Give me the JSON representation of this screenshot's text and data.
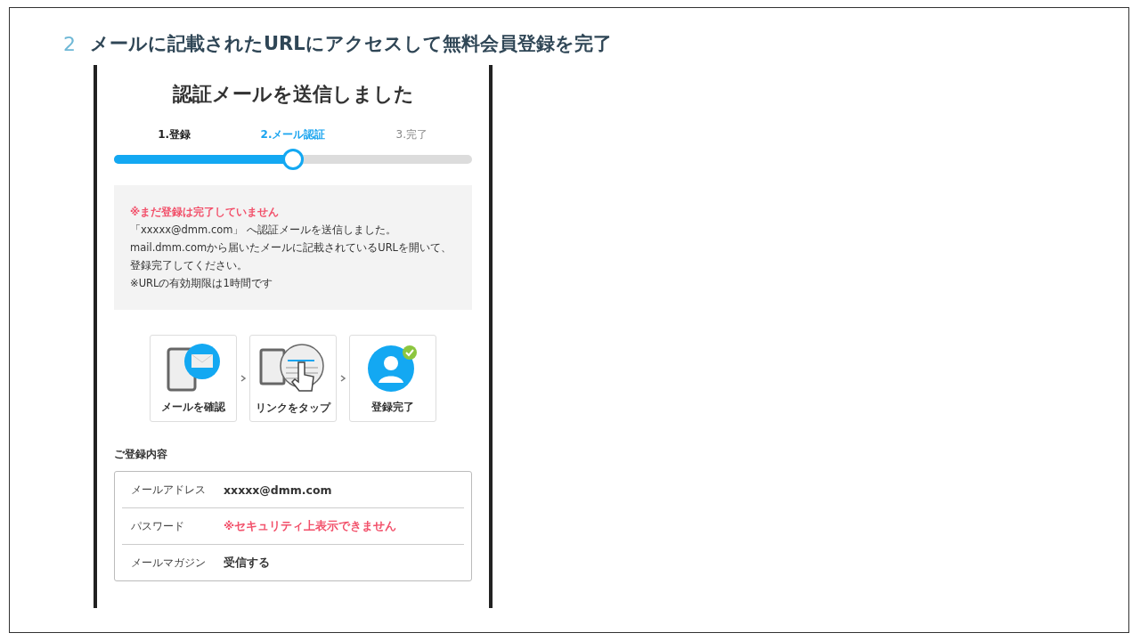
{
  "heading": {
    "number": "2",
    "text": "メールに記載されたURLにアクセスして無料会員登録を完了"
  },
  "screen": {
    "title": "認証メールを送信しました",
    "steps": [
      {
        "label": "1.登録",
        "kind": "done"
      },
      {
        "label": "2.メール認証",
        "kind": "current"
      },
      {
        "label": "3.完了",
        "kind": "upcoming"
      }
    ],
    "progress": {
      "level": 0.5
    },
    "notice": {
      "warning": "※まだ登録は完了していません",
      "lines": [
        "「xxxxx@dmm.com」 へ認証メールを送信しました。",
        "mail.dmm.comから届いたメールに記載されているURLを開いて、登録完了してください。",
        "※URLの有効期限は1時間です"
      ]
    },
    "flow": [
      {
        "kind": "mail",
        "label": "メールを確認"
      },
      {
        "kind": "link",
        "label": "リンクをタップ"
      },
      {
        "kind": "done",
        "label": "登録完了"
      }
    ],
    "section_title": "ご登録内容",
    "rows": [
      {
        "label": "メールアドレス",
        "value": "xxxxx@dmm.com",
        "kind": "normal"
      },
      {
        "label": "パスワード",
        "value": "※セキュリティ上表示できません",
        "kind": "alert"
      },
      {
        "label": "メールマガジン",
        "value": "受信する",
        "kind": "normal"
      }
    ]
  }
}
